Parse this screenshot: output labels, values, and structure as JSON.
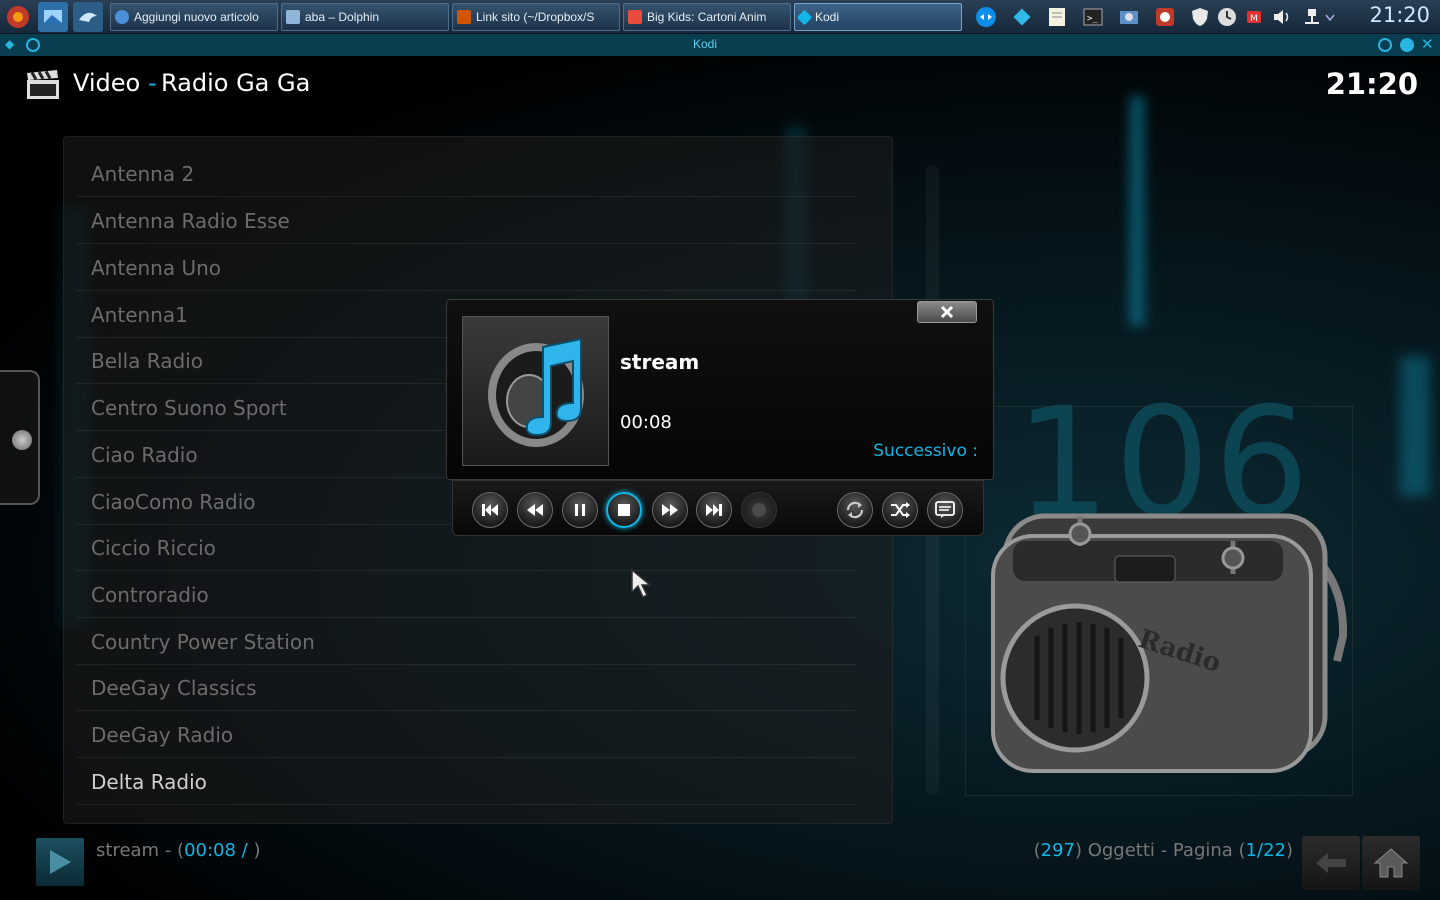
{
  "taskbar": {
    "tasks": [
      {
        "label": "Aggiungi nuovo articolo",
        "icon": "chrome-icon"
      },
      {
        "label": "aba – Dolphin",
        "icon": "folder-icon"
      },
      {
        "label": "Link sito (~/Dropbox/S",
        "icon": "text-editor-icon"
      },
      {
        "label": "Big Kids: Cartoni Anim",
        "icon": "media-player-icon"
      },
      {
        "label": "Kodi",
        "icon": "kodi-icon"
      }
    ],
    "clock": "21:20",
    "colors": {
      "bar": "#1d3249",
      "accent": "#7aa3c8"
    }
  },
  "window": {
    "title": "Kodi"
  },
  "header": {
    "section": "Video",
    "separator": "-",
    "subtitle": "Radio Ga Ga",
    "clock": "21:20"
  },
  "list": {
    "items": [
      "Antenna 2",
      "Antenna Radio Esse",
      "Antenna Uno",
      "Antenna1",
      "Bella Radio",
      "Centro Suono Sport",
      "Ciao Radio",
      "CiaoComo Radio",
      "Ciccio Riccio",
      "Controradio",
      "Country Power Station",
      "DeeGay Classics",
      "DeeGay Radio",
      "Delta Radio"
    ],
    "focused_index": 13
  },
  "background": {
    "number": "106"
  },
  "osd": {
    "title": "stream",
    "time": "00:08",
    "next_label": "Successivo :",
    "accent": "#12b5e5",
    "controls": [
      {
        "name": "previous-track-button",
        "icon": "skip-back-icon"
      },
      {
        "name": "rewind-button",
        "icon": "rewind-icon"
      },
      {
        "name": "pause-button",
        "icon": "pause-icon"
      },
      {
        "name": "stop-button",
        "icon": "stop-icon",
        "focused": true
      },
      {
        "name": "fast-forward-button",
        "icon": "fast-forward-icon"
      },
      {
        "name": "next-track-button",
        "icon": "skip-forward-icon"
      },
      {
        "name": "record-button",
        "icon": "record-icon"
      },
      {
        "name": "repeat-button",
        "icon": "repeat-icon"
      },
      {
        "name": "shuffle-button",
        "icon": "shuffle-icon"
      },
      {
        "name": "subtitles-button",
        "icon": "subtitles-icon"
      }
    ]
  },
  "footer": {
    "status_title": "stream",
    "status_dash": " - (",
    "status_time": "00:08 /",
    "status_close": " )",
    "count_open": "(",
    "count": "297",
    "count_mid": ") Oggetti - Pagina (",
    "page": "1/22",
    "count_close": ")"
  }
}
